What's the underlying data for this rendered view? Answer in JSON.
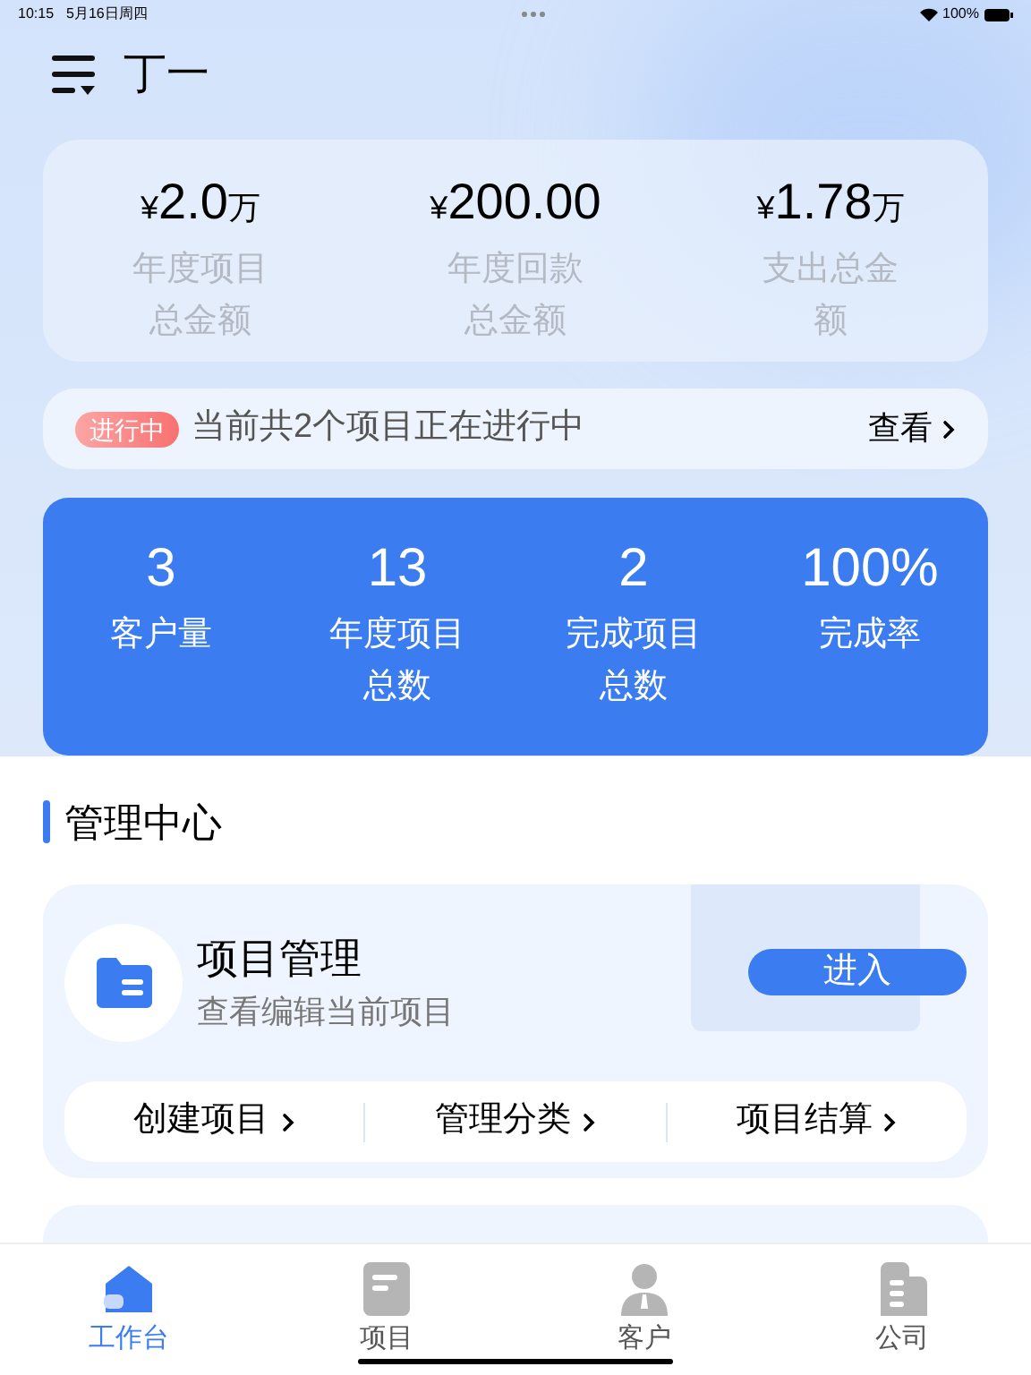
{
  "status_bar": {
    "time": "10:15",
    "date": "5月16日周四",
    "battery": "100%"
  },
  "header": {
    "title": "丁一"
  },
  "summary": [
    {
      "currency": "¥",
      "amount": "2.0",
      "unit": "万",
      "label": "年度项目总金额"
    },
    {
      "currency": "¥",
      "amount": "200.00",
      "label": "年度回款总金额"
    },
    {
      "currency": "¥",
      "amount": "1.78",
      "unit": "万",
      "label": "支出总金额"
    }
  ],
  "notice": {
    "badge": "进行中",
    "text": "当前共2个项目正在进行中",
    "link": "查看"
  },
  "stats": [
    {
      "value": "3",
      "label": "客户量"
    },
    {
      "value": "13",
      "label": "年度项目总数"
    },
    {
      "value": "2",
      "label": "完成项目总数"
    },
    {
      "value": "100%",
      "label": "完成率"
    }
  ],
  "section_title": "管理中心",
  "module": {
    "title": "项目管理",
    "subtitle": "查看编辑当前项目",
    "button": "进入",
    "actions": [
      "创建项目",
      "管理分类",
      "项目结算"
    ]
  },
  "tabs": [
    {
      "label": "工作台",
      "selected": true,
      "kind": "home"
    },
    {
      "label": "项目",
      "selected": false,
      "kind": "doc"
    },
    {
      "label": "客户",
      "selected": false,
      "kind": "person"
    },
    {
      "label": "公司",
      "selected": false,
      "kind": "company"
    }
  ]
}
